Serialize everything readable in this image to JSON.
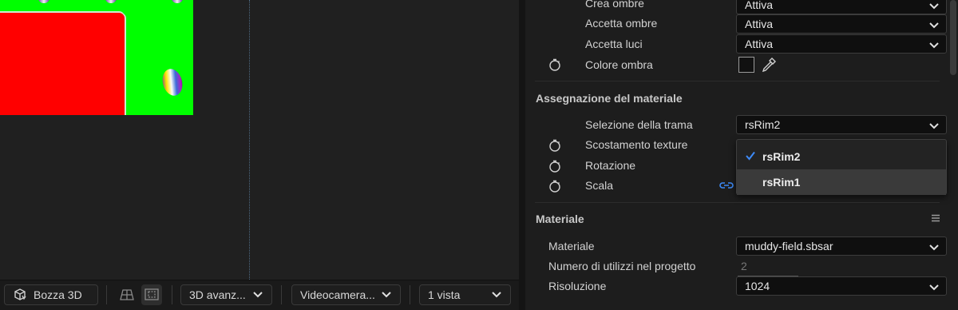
{
  "toolbar": {
    "draft_3d_label": "Bozza 3D",
    "renderer_label": "3D avanz...",
    "camera_label": "Videocamera...",
    "views_label": "1 vista",
    "icons": [
      "draft-3d-icon",
      "ground-plane-icon",
      "region-of-interest-icon"
    ]
  },
  "panel": {
    "rows_top": [
      {
        "label": "Crea ombre",
        "value": "Attiva"
      },
      {
        "label": "Accetta ombre",
        "value": "Attiva"
      },
      {
        "label": "Accetta luci",
        "value": "Attiva"
      }
    ],
    "shadow_color_label": "Colore ombra",
    "shadow_color": "#111111",
    "material_assignment": {
      "title": "Assegnazione del materiale",
      "texture_selection_label": "Selezione della trama",
      "texture_selection_value": "rsRim2",
      "texture_offset_label": "Scostamento texture",
      "rotation_label": "Rotazione",
      "scale_label": "Scala",
      "dropdown_options": [
        "rsRim2",
        "rsRim1"
      ],
      "selected_option": "rsRim2"
    },
    "material": {
      "title": "Materiale",
      "material_label": "Materiale",
      "material_value": "muddy-field.sbsar",
      "uses_label": "Numero di utilizzi nel progetto",
      "uses_value": "2",
      "resolution_label": "Risoluzione",
      "resolution_value": "1024"
    }
  },
  "colors": {
    "accent_blue": "#3d8af7",
    "comp_green": "#00ff00",
    "comp_red": "#ff0000"
  }
}
